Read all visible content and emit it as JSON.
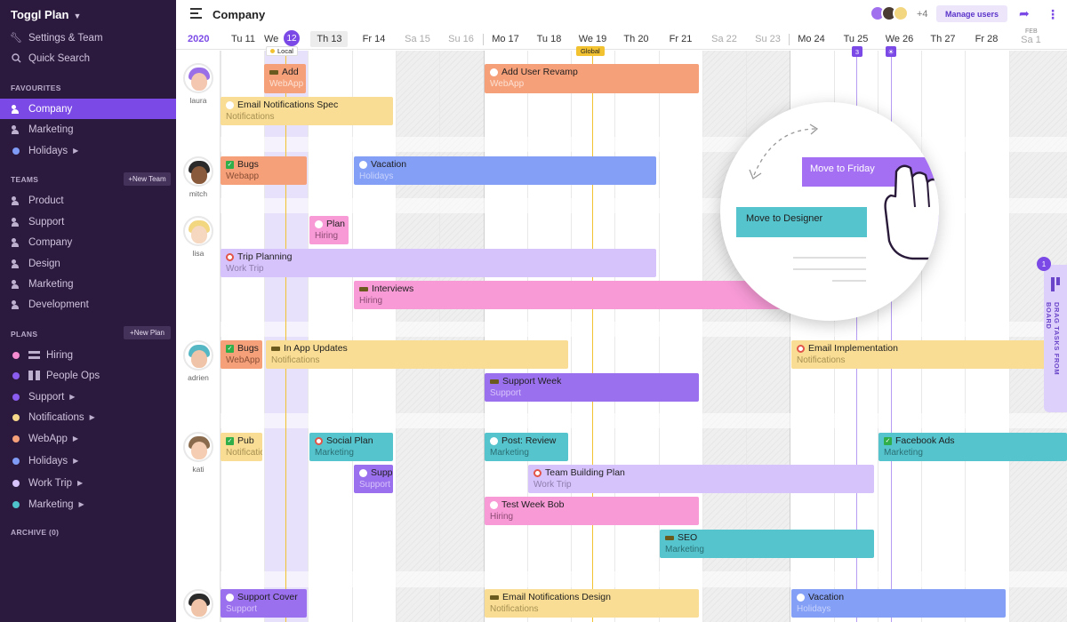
{
  "app": {
    "brand": "Toggl Plan"
  },
  "sidebar": {
    "top_items": [
      {
        "label": "Settings & Team",
        "icon": "wrench-icon"
      },
      {
        "label": "Quick Search",
        "icon": "search-icon"
      }
    ],
    "favourites_label": "FAVOURITES",
    "favourites": [
      {
        "label": "Company",
        "type": "team",
        "active": true
      },
      {
        "label": "Marketing",
        "type": "team"
      },
      {
        "label": "Holidays",
        "type": "plan",
        "color": "#7f9bf5",
        "arrow": true
      }
    ],
    "teams_label": "TEAMS",
    "new_team_label": "+New Team",
    "teams": [
      "Product",
      "Support",
      "Company",
      "Design",
      "Marketing",
      "Development"
    ],
    "plans_label": "PLANS",
    "new_plan_label": "+New Plan",
    "plans": [
      {
        "label": "Hiring",
        "color": "#f58bd1",
        "icon": "timeline-icon"
      },
      {
        "label": "People Ops",
        "color": "#8a5cf0",
        "icon": "board-icon"
      },
      {
        "label": "Support",
        "color": "#8a5cf0",
        "arrow": true
      },
      {
        "label": "Notifications",
        "color": "#f7d88a",
        "arrow": true
      },
      {
        "label": "WebApp",
        "color": "#f6a07a",
        "arrow": true
      },
      {
        "label": "Holidays",
        "color": "#7f9bf5",
        "arrow": true
      },
      {
        "label": "Work Trip",
        "color": "#d7c2fa",
        "arrow": true
      },
      {
        "label": "Marketing",
        "color": "#4fc3cc",
        "arrow": true
      }
    ],
    "archive_label": "ARCHIVE (0)"
  },
  "topbar": {
    "title": "Company",
    "more_users": "+4",
    "manage_users_label": "Manage users"
  },
  "calendar": {
    "year": "2020",
    "days": [
      {
        "label": "Tu 11"
      },
      {
        "label": "We",
        "today": "12"
      },
      {
        "label": "Th 13",
        "hl": true
      },
      {
        "label": "Fr 14"
      },
      {
        "label": "Sa 15",
        "we": true
      },
      {
        "label": "Su 16",
        "we": true
      },
      {
        "label": "Mo 17",
        "monday": true
      },
      {
        "label": "Tu 18"
      },
      {
        "label": "We 19"
      },
      {
        "label": "Th 20"
      },
      {
        "label": "Fr 21"
      },
      {
        "label": "Sa 22",
        "we": true
      },
      {
        "label": "Su 23",
        "we": true
      },
      {
        "label": "Mo 24",
        "monday": true
      },
      {
        "label": "Tu 25"
      },
      {
        "label": "We 26"
      },
      {
        "label": "Th 27"
      },
      {
        "label": "Fr 28"
      },
      {
        "label": "Sa 1",
        "we": true,
        "month": "FEB"
      }
    ],
    "markers": {
      "local": "Local",
      "global": "Global",
      "count": "3"
    }
  },
  "people": [
    {
      "name": "laura",
      "hair": "#9a6ee6",
      "skin": "#f4c7b0"
    },
    {
      "name": "mitch",
      "hair": "#2b2b2b",
      "skin": "#8a5a3c"
    },
    {
      "name": "lisa",
      "hair": "#f2d680",
      "skin": "#f6d7c0"
    },
    {
      "name": "adrien",
      "hair": "#56b7c4",
      "skin": "#f0c4a8"
    },
    {
      "name": "kati",
      "hair": "#8a6a4c",
      "skin": "#f4cdb3"
    },
    {
      "name": "",
      "hair": "#2b2b2b",
      "skin": "#f0c4a8"
    }
  ],
  "tasks": [
    {
      "title": "Add",
      "plan": "WebApp",
      "icon": "bar",
      "color": "#f6a07a",
      "sub": "#fbe0d2"
    },
    {
      "title": "Add User Revamp",
      "plan": "WebApp",
      "icon": "speech",
      "color": "#f6a07a",
      "sub": "#fbe0d2"
    },
    {
      "title": "Email Notifications Spec",
      "plan": "Notifications",
      "icon": "speech",
      "color": "#f9dd94",
      "sub": "#a69052"
    },
    {
      "title": "Bugs",
      "plan": "Webapp",
      "icon": "check",
      "color": "#f6a07a",
      "sub": "#8a4f35"
    },
    {
      "title": "Vacation",
      "plan": "Holidays",
      "icon": "speech",
      "color": "#849ff6",
      "sub": "#c8d3fb"
    },
    {
      "title": "Plan",
      "plan": "Hiring",
      "icon": "speech",
      "color": "#f79ad6",
      "sub": "#8d4c74"
    },
    {
      "title": "Trip Planning",
      "plan": "Work Trip",
      "icon": "block",
      "color": "#d6c3fb",
      "sub": "#8d7cab"
    },
    {
      "title": "Interviews",
      "plan": "Hiring",
      "icon": "bar",
      "color": "#f79ad6",
      "sub": "#8d4c74"
    },
    {
      "title": "Bugs",
      "plan": "WebApp",
      "icon": "check",
      "color": "#f6a07a",
      "sub": "#8a4f35"
    },
    {
      "title": "In App Updates",
      "plan": "Notifications",
      "icon": "bar",
      "color": "#f9dd94",
      "sub": "#a69052"
    },
    {
      "title": "Email Implementation",
      "plan": "Notifications",
      "icon": "block",
      "color": "#f9dd94",
      "sub": "#a69052"
    },
    {
      "title": "Support Week",
      "plan": "Support",
      "icon": "bar",
      "color": "#9b70ee",
      "sub": "#d7c4fa"
    },
    {
      "title": "Pub",
      "plan": "Notifications",
      "icon": "check",
      "color": "#f9dd94",
      "sub": "#a69052"
    },
    {
      "title": "Social Plan",
      "plan": "Marketing",
      "icon": "block",
      "color": "#56c4cd",
      "sub": "#2a6f74"
    },
    {
      "title": "Post: Review",
      "plan": "Marketing",
      "icon": "speech",
      "color": "#56c4cd",
      "sub": "#2a6f74"
    },
    {
      "title": "Facebook Ads",
      "plan": "Marketing",
      "icon": "check",
      "color": "#56c4cd",
      "sub": "#2a6f74"
    },
    {
      "title": "Supp",
      "plan": "Support",
      "icon": "speech",
      "color": "#9b70ee",
      "sub": "#d7c4fa"
    },
    {
      "title": "Team Building Plan",
      "plan": "Work Trip",
      "icon": "block",
      "color": "#d6c3fb",
      "sub": "#8d7cab"
    },
    {
      "title": "Test Week Bob",
      "plan": "Hiring",
      "icon": "speech",
      "color": "#f79ad6",
      "sub": "#8d4c74"
    },
    {
      "title": "SEO",
      "plan": "Marketing",
      "icon": "bar",
      "color": "#56c4cd",
      "sub": "#2a6f74"
    },
    {
      "title": "Support Cover",
      "plan": "Support",
      "icon": "speech",
      "color": "#9b70ee",
      "sub": "#d7c4fa"
    },
    {
      "title": "Email Notifications Design",
      "plan": "Notifications",
      "icon": "bar",
      "color": "#f9dd94",
      "sub": "#a69052"
    },
    {
      "title": "Vacation",
      "plan": "Holidays",
      "icon": "speech",
      "color": "#849ff6",
      "sub": "#c8d3fb"
    }
  ],
  "overlay": {
    "move_friday": "Move to Friday",
    "move_designer": "Move to Designer"
  },
  "drag_panel": {
    "label": "DRAG TASKS FROM BOARD",
    "badge": "1"
  }
}
